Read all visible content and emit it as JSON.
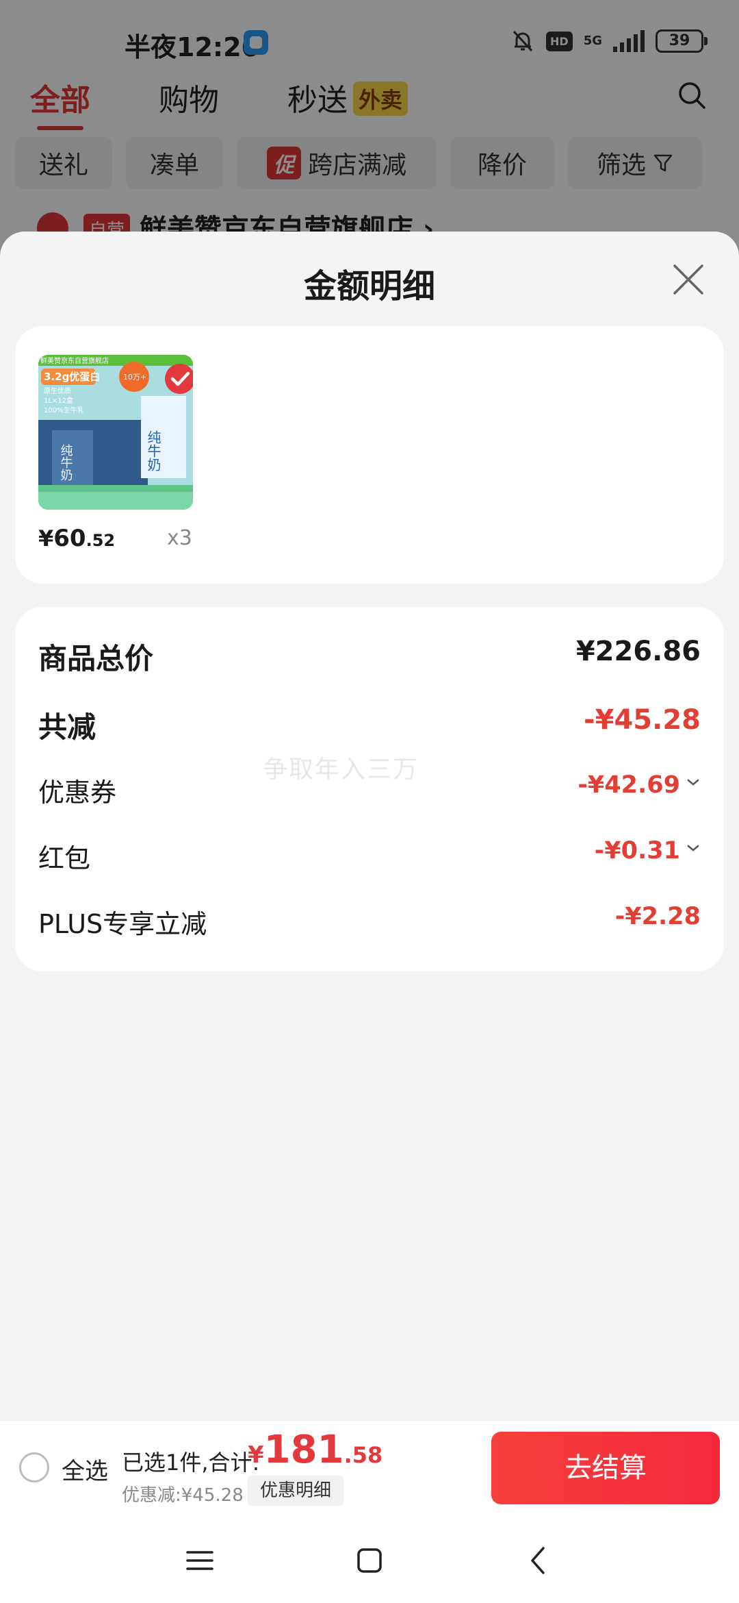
{
  "status_bar": {
    "time": "半夜12:26",
    "signal": "5G",
    "hd": "HD",
    "battery": "39"
  },
  "top_tabs": [
    {
      "label": "全部",
      "active": true
    },
    {
      "label": "购物",
      "active": false
    },
    {
      "label": "秒送",
      "active": false,
      "badge": "外卖"
    }
  ],
  "filters": [
    {
      "label": "送礼"
    },
    {
      "label": "凑单"
    },
    {
      "label": "跨店满减",
      "tag": "促"
    },
    {
      "label": "降价"
    },
    {
      "label": "筛选"
    }
  ],
  "store": {
    "self_operated_tag": "自营",
    "name": "鲜美赞京东自营旗舰店 ›"
  },
  "sheet": {
    "title": "金额明细"
  },
  "product": {
    "price_currency": "¥",
    "price_integer": "60",
    "price_decimal": ".52",
    "quantity": "x3",
    "thumb_top_text": "鲜美赞京东自营旗舰店",
    "thumb_protein": "3.2g优蛋白",
    "thumb_sub": "原生优质",
    "thumb_spec": "1L×12盒",
    "thumb_milk": "100%生牛乳",
    "thumb_sales": "10万+",
    "thumb_pack_text": "纯牛奶"
  },
  "breakdown": {
    "rows": [
      {
        "label": "商品总价",
        "value": "¥226.86"
      },
      {
        "label": "共减",
        "value": "-¥45.28"
      },
      {
        "label": "优惠券",
        "value": "-¥42.69"
      },
      {
        "label": "红包",
        "value": "-¥0.31"
      },
      {
        "label": "PLUS专享立减",
        "value": "-¥2.28"
      }
    ]
  },
  "watermark": "争取年入三万",
  "checkout": {
    "select_all": "全选",
    "summary": "已选1件,合计:",
    "total_currency": "¥",
    "total_integer": "181",
    "total_decimal": ".58",
    "discount": "优惠减:¥45.28",
    "discount_detail": "优惠明细",
    "checkout_button": "去结算"
  },
  "colors": {
    "accent_red": "#e4393c",
    "discount_red": "#e33e33",
    "badge_yellow": "#f7d94c"
  }
}
